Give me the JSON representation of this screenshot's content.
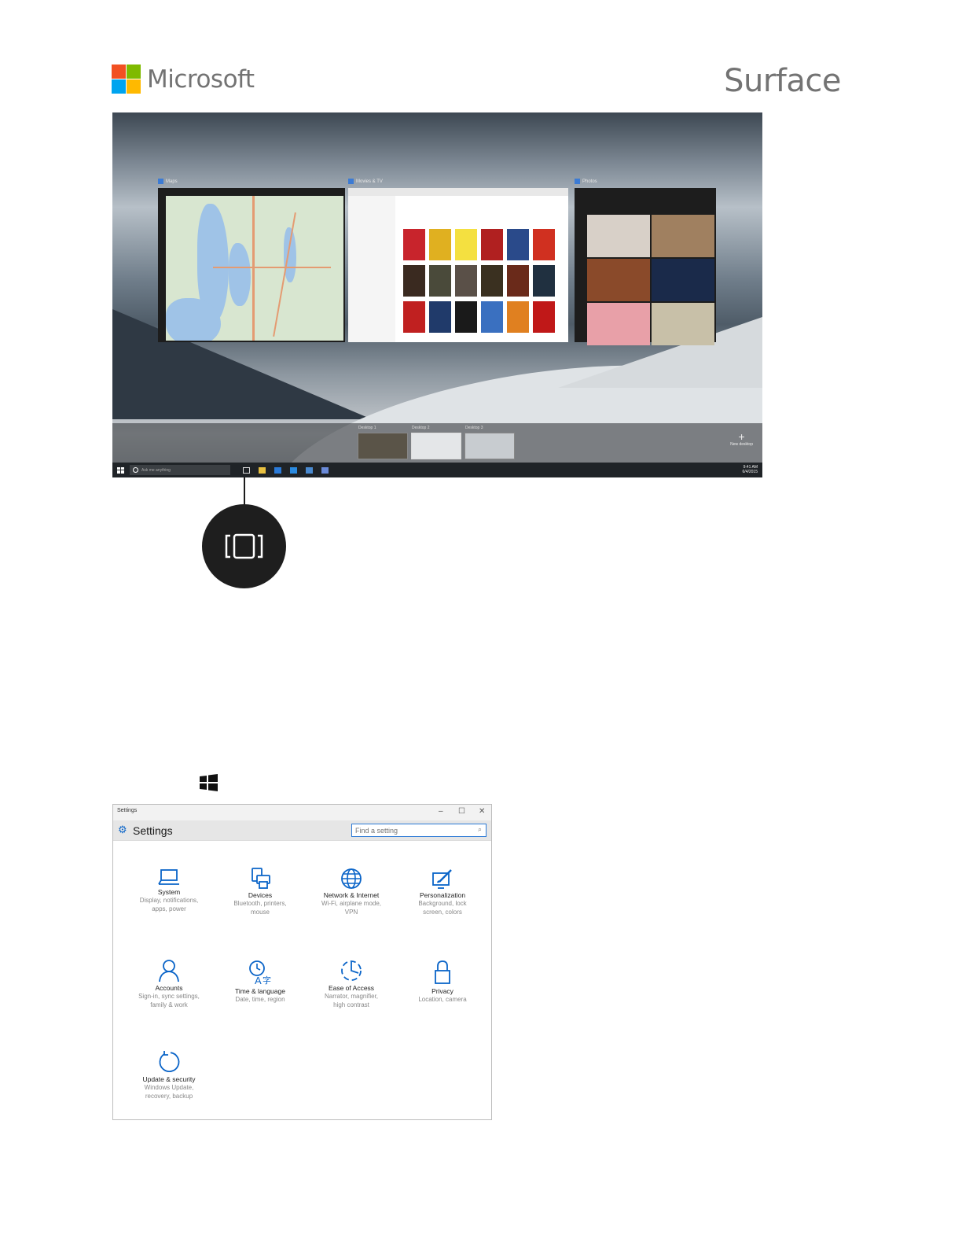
{
  "header": {
    "microsoft_wordmark": "Microsoft",
    "surface_wordmark": "Surface",
    "logo_colors": [
      "#f25022",
      "#7fba00",
      "#00a4ef",
      "#ffb900"
    ]
  },
  "taskview": {
    "windows": [
      {
        "title": "Maps"
      },
      {
        "title": "Movies & TV"
      },
      {
        "title": "Photos"
      }
    ],
    "desktops": [
      "Desktop 1",
      "Desktop 2",
      "Desktop 3"
    ],
    "new_desktop_label": "New desktop",
    "search_placeholder": "Ask me anything",
    "tray_time": "9:41 AM",
    "tray_date": "6/4/2015"
  },
  "callout": {
    "icon": "task-view-icon"
  },
  "windows_key": {
    "icon": "windows-logo-icon"
  },
  "settings": {
    "window_title": "Settings",
    "minimize": "–",
    "maximize": "☐",
    "close": "✕",
    "heading": "Settings",
    "search_placeholder": "Find a setting",
    "accent": "#0a64c8",
    "tiles": [
      {
        "name": "System",
        "desc1": "Display, notifications,",
        "desc2": "apps, power",
        "icon": "laptop-icon"
      },
      {
        "name": "Devices",
        "desc1": "Bluetooth, printers,",
        "desc2": "mouse",
        "icon": "devices-icon"
      },
      {
        "name": "Network & Internet",
        "desc1": "Wi-Fi, airplane mode,",
        "desc2": "VPN",
        "icon": "globe-icon"
      },
      {
        "name": "Personalization",
        "desc1": "Background, lock",
        "desc2": "screen, colors",
        "icon": "paint-icon"
      },
      {
        "name": "Accounts",
        "desc1": "Sign-in, sync settings,",
        "desc2": "family & work",
        "icon": "person-icon"
      },
      {
        "name": "Time & language",
        "desc1": "Date, time, region",
        "desc2": "",
        "icon": "time-language-icon"
      },
      {
        "name": "Ease of Access",
        "desc1": "Narrator, magnifier,",
        "desc2": "high contrast",
        "icon": "ease-of-access-icon"
      },
      {
        "name": "Privacy",
        "desc1": "Location, camera",
        "desc2": "",
        "icon": "lock-icon"
      },
      {
        "name": "Update & security",
        "desc1": "Windows Update,",
        "desc2": "recovery, backup",
        "icon": "refresh-icon"
      }
    ]
  }
}
